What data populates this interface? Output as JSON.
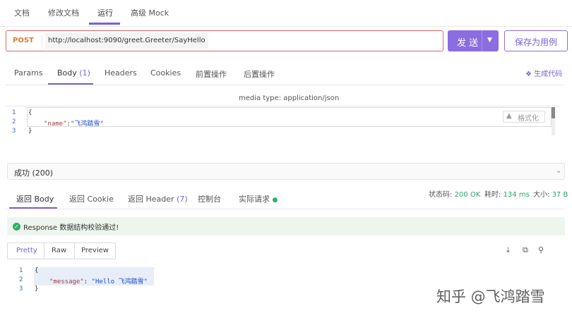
{
  "top_tabs": [
    {
      "label": "文档"
    },
    {
      "label": "修改文档"
    },
    {
      "label": "运行"
    },
    {
      "label": "高级 Mock"
    }
  ],
  "request": {
    "method": "POST",
    "url": "http://localhost:9090/greet.Greeter/SayHello",
    "send_label": "发 送",
    "save_label": "保存为用例"
  },
  "request_tabs": {
    "params": "Params",
    "body": "Body",
    "body_count": "(1)",
    "headers": "Headers",
    "cookies": "Cookies",
    "pre_ops": "前置操作",
    "post_ops": "后置操作",
    "gen_code": "生成代码"
  },
  "media_type": "media type: application/json",
  "request_body": {
    "line_numbers": [
      "1",
      "2",
      "3"
    ],
    "open_brace": "{",
    "key": "\"name\"",
    "colon": ":",
    "value": "\"飞鸿踏雪\"",
    "close_brace": "}",
    "format_label": "格式化"
  },
  "response": {
    "status": "成功 (200)",
    "tabs": {
      "body": "返回 Body",
      "cookie": "返回 Cookie",
      "header": "返回 Header",
      "header_count": "(7)",
      "console": "控制台",
      "actual": "实际请求"
    },
    "metrics": {
      "status_label": "状态码:",
      "status_value": "200 OK",
      "time_label": "耗时:",
      "time_value": "134 ms",
      "size_label": "大小:",
      "size_value": "37 B"
    },
    "validation": "Response 数据结构校验通过!",
    "view_modes": [
      "Pretty",
      "Raw",
      "Preview"
    ],
    "body_lines": [
      "1",
      "2",
      "3"
    ],
    "open_brace": "{",
    "key": "\"message\"",
    "colon": ": ",
    "value": "\"Hello 飞鸿踏雪\"",
    "close_brace": "}"
  },
  "watermark": "知乎 @飞鸿踏雪",
  "colors": {
    "accent": "#8c6de0",
    "method": "#e07a2e",
    "success": "#2fae6b",
    "url_border": "#e06666"
  },
  "icons": [
    "download-icon",
    "copy-icon",
    "search-icon",
    "check-circle-icon",
    "cube-icon",
    "chevron-down-icon",
    "format-icon"
  ]
}
